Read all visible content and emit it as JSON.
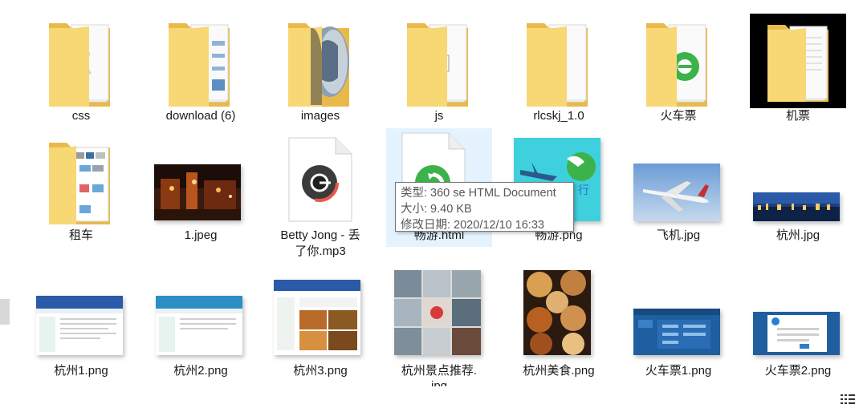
{
  "items": [
    {
      "name": "css"
    },
    {
      "name": "download (6)"
    },
    {
      "name": "images"
    },
    {
      "name": "js"
    },
    {
      "name": "rlcskj_1.0"
    },
    {
      "name": "火车票"
    },
    {
      "name": "机票"
    },
    {
      "name": "租车"
    },
    {
      "name": "1.jpeg"
    },
    {
      "name": "Betty Jong - 丢了你.mp3",
      "line1": "Betty Jong - 丢",
      "line2": "了你.mp3"
    },
    {
      "name": "畅游.html"
    },
    {
      "name": "畅游.png"
    },
    {
      "name": "飞机.jpg"
    },
    {
      "name": "杭州.jpg"
    },
    {
      "name": "杭州1.png"
    },
    {
      "name": "杭州2.png"
    },
    {
      "name": "杭州3.png"
    },
    {
      "name": "杭州景点推荐.jpg",
      "line1": "杭州景点推荐.",
      "line2": "jpg"
    },
    {
      "name": "杭州美食.png"
    },
    {
      "name": "火车票1.png"
    },
    {
      "name": "火车票2.png"
    }
  ],
  "tooltip": {
    "type": "类型: 360 se HTML Document",
    "size": "大小: 9.40 KB",
    "modified": "修改日期: 2020/12/10 16:33"
  },
  "colors": {
    "folder": "#f8d775",
    "folder_dark": "#e9b94a",
    "selection": "#e5f3ff",
    "black_bg": "#000000"
  },
  "icons": {
    "mp3": "audio-file-icon",
    "html": "360-browser-html-icon",
    "view": "details-view-icon"
  }
}
